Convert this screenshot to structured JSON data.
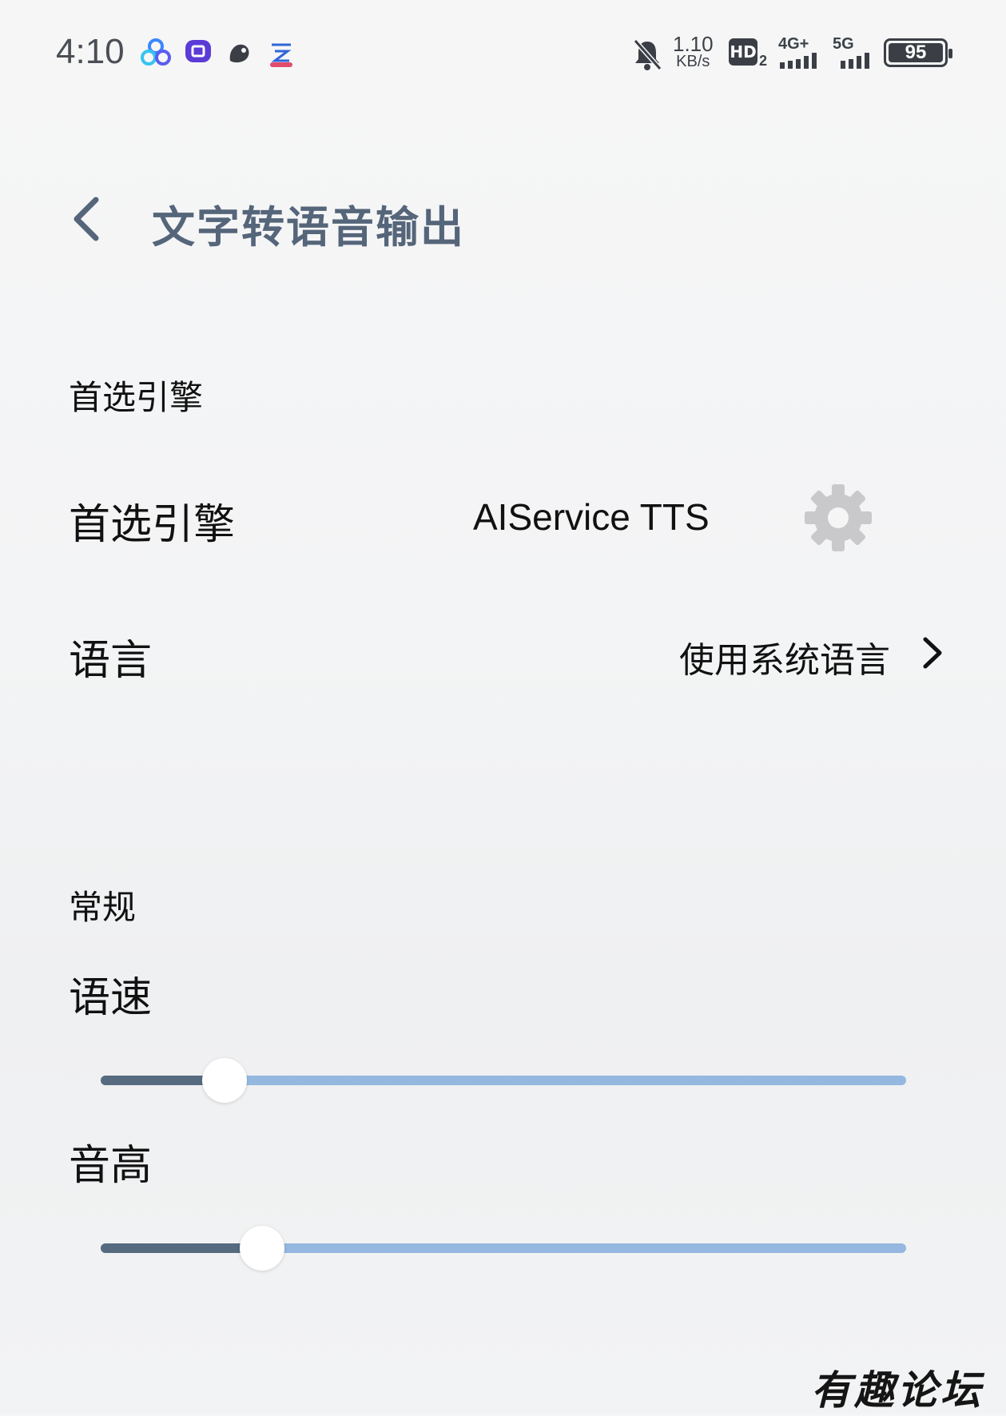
{
  "status_bar": {
    "time": "4:10",
    "app_icons": [
      "baidu-netdisk-icon",
      "tieba-icon",
      "squirrel-icon",
      "cloud-ai-icon"
    ],
    "mute_icon": "bell-off-icon",
    "net_speed_value": "1.10",
    "net_speed_unit": "KB/s",
    "hd_label": "HD",
    "hd_sub": "2",
    "signal_1": "4G+",
    "signal_2": "5G",
    "battery": "95"
  },
  "header": {
    "back_icon": "chevron-left-icon",
    "title": "文字转语音输出"
  },
  "engine_section": {
    "heading": "首选引擎",
    "engine_label": "首选引擎",
    "engine_value": "AIService TTS",
    "settings_icon": "gear-icon",
    "language_label": "语言",
    "language_value": "使用系统语言",
    "language_chevron": "chevron-right-icon"
  },
  "general_section": {
    "heading": "常规",
    "speech_rate_label": "语速",
    "speech_rate_value": 0.154,
    "pitch_label": "音高",
    "pitch_value": 0.2
  },
  "watermark": "有趣论坛",
  "colors": {
    "title": "#55657a",
    "slider_fill": "#566b80",
    "slider_track": "#94b8df",
    "gear": "#c9c9cb"
  }
}
